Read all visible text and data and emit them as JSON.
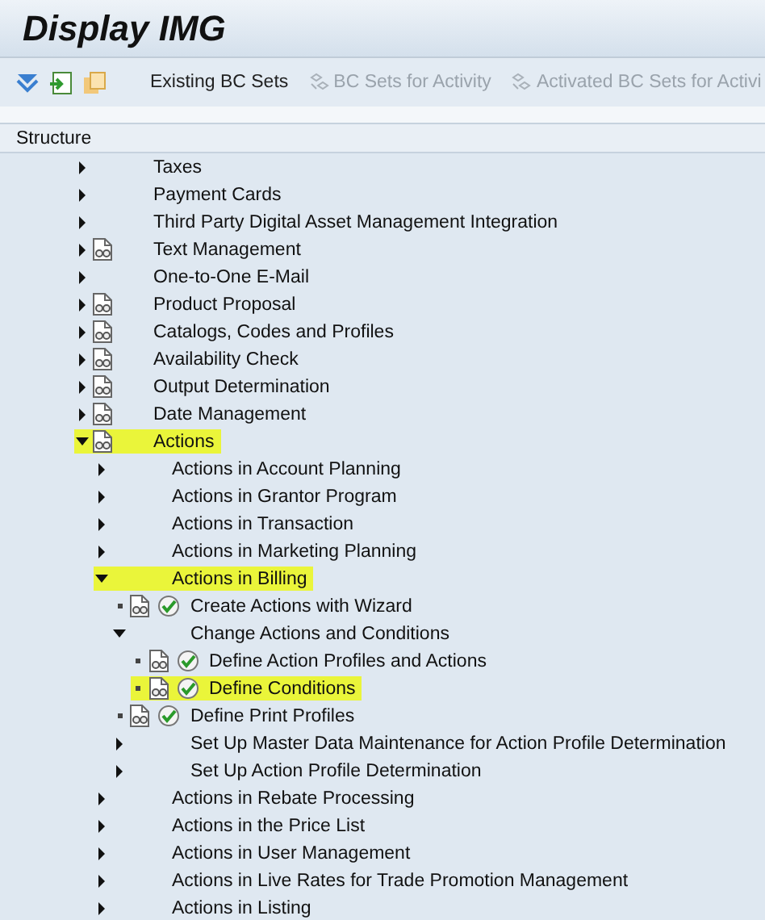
{
  "window": {
    "title": "Display IMG"
  },
  "toolbar": {
    "buttons": [
      {
        "label": "Existing BC Sets",
        "disabled": false
      },
      {
        "label": "BC Sets for Activity",
        "disabled": true
      },
      {
        "label": "Activated BC Sets for Activi",
        "disabled": true
      }
    ]
  },
  "tree": {
    "header": "Structure",
    "items": [
      {
        "kind": "folder",
        "label": "Taxes",
        "expanded": false,
        "doc": false,
        "highlighted": false
      },
      {
        "kind": "folder",
        "label": "Payment Cards",
        "expanded": false,
        "doc": false,
        "highlighted": false
      },
      {
        "kind": "folder",
        "label": "Third Party Digital Asset Management Integration",
        "expanded": false,
        "doc": false,
        "highlighted": false
      },
      {
        "kind": "folder",
        "label": "Text Management",
        "expanded": false,
        "doc": true,
        "highlighted": false
      },
      {
        "kind": "folder",
        "label": "One-to-One E-Mail",
        "expanded": false,
        "doc": false,
        "highlighted": false
      },
      {
        "kind": "folder",
        "label": "Product Proposal",
        "expanded": false,
        "doc": true,
        "highlighted": false
      },
      {
        "kind": "folder",
        "label": "Catalogs, Codes and Profiles",
        "expanded": false,
        "doc": true,
        "highlighted": false
      },
      {
        "kind": "folder",
        "label": "Availability Check",
        "expanded": false,
        "doc": true,
        "highlighted": false
      },
      {
        "kind": "folder",
        "label": "Output Determination",
        "expanded": false,
        "doc": true,
        "highlighted": false
      },
      {
        "kind": "folder",
        "label": "Date Management",
        "expanded": false,
        "doc": true,
        "highlighted": false
      },
      {
        "kind": "folder",
        "label": "Actions",
        "expanded": true,
        "doc": true,
        "highlighted": true,
        "children": [
          {
            "kind": "folder",
            "label": "Actions in Account Planning",
            "expanded": false,
            "doc": false,
            "highlighted": false
          },
          {
            "kind": "folder",
            "label": "Actions in Grantor Program",
            "expanded": false,
            "doc": false,
            "highlighted": false
          },
          {
            "kind": "folder",
            "label": "Actions in Transaction",
            "expanded": false,
            "doc": false,
            "highlighted": false
          },
          {
            "kind": "folder",
            "label": "Actions in Marketing Planning",
            "expanded": false,
            "doc": false,
            "highlighted": false
          },
          {
            "kind": "folder",
            "label": "Actions in Billing",
            "expanded": true,
            "doc": false,
            "highlighted": true,
            "children": [
              {
                "kind": "activity",
                "label": "Create Actions with Wizard",
                "highlighted": false
              },
              {
                "kind": "folder",
                "label": "Change Actions and Conditions",
                "expanded": true,
                "doc": false,
                "highlighted": false,
                "children": [
                  {
                    "kind": "activity",
                    "label": "Define Action Profiles and Actions",
                    "highlighted": false
                  },
                  {
                    "kind": "activity",
                    "label": "Define Conditions",
                    "highlighted": true
                  }
                ]
              },
              {
                "kind": "activity",
                "label": "Define Print Profiles",
                "highlighted": false
              },
              {
                "kind": "folder",
                "label": "Set Up Master Data Maintenance for Action Profile Determination",
                "expanded": false,
                "doc": false,
                "highlighted": false
              },
              {
                "kind": "folder",
                "label": "Set Up Action Profile Determination",
                "expanded": false,
                "doc": false,
                "highlighted": false
              }
            ]
          },
          {
            "kind": "folder",
            "label": "Actions in Rebate Processing",
            "expanded": false,
            "doc": false,
            "highlighted": false
          },
          {
            "kind": "folder",
            "label": "Actions in the Price List",
            "expanded": false,
            "doc": false,
            "highlighted": false
          },
          {
            "kind": "folder",
            "label": "Actions in User Management",
            "expanded": false,
            "doc": false,
            "highlighted": false
          },
          {
            "kind": "folder",
            "label": "Actions in Live Rates for Trade Promotion Management",
            "expanded": false,
            "doc": false,
            "highlighted": false
          },
          {
            "kind": "folder",
            "label": "Actions in Listing",
            "expanded": false,
            "doc": false,
            "highlighted": false
          }
        ]
      }
    ]
  }
}
